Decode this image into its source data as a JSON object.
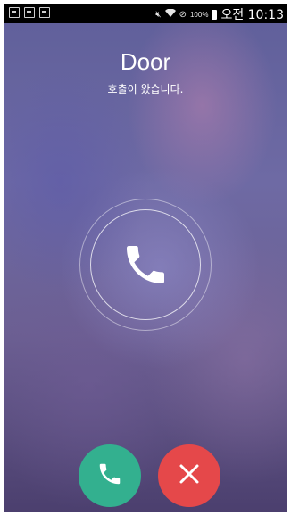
{
  "status_bar": {
    "left_icons": [
      "screen-icon",
      "screen-icon",
      "document-icon"
    ],
    "mute_icon": "mute-icon",
    "wifi_icon": "wifi-icon",
    "dnd_icon": "do-not-disturb-icon",
    "battery_percent": "100%",
    "time": "오전 10:13"
  },
  "call": {
    "caller_name": "Door",
    "status_text": "호출이 왔습니다.",
    "center_icon": "phone-icon"
  },
  "actions": {
    "accept_icon": "phone-icon",
    "decline_icon": "close-icon",
    "accept_color": "#33b08f",
    "decline_color": "#e5484a"
  }
}
